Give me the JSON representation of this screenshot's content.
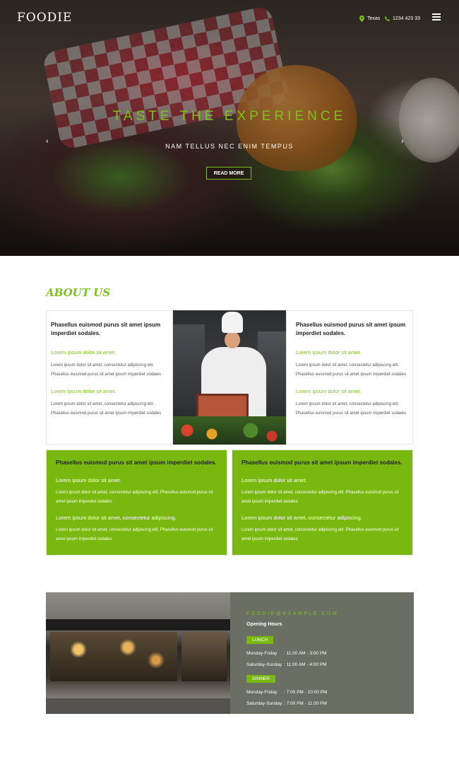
{
  "header": {
    "logo": "FOODIE",
    "location": "Texas",
    "phone": "1234 423 33"
  },
  "hero": {
    "title": "TASTE THE EXPERIENCE",
    "subtitle": "NAM TELLUS NEC ENIM TEMPUS",
    "button": "READ MORE",
    "prev_arrow": "‹",
    "next_arrow": "›"
  },
  "about": {
    "title": "ABOUT US",
    "left_card": {
      "heading": "Phasellus euismod purus sit amet ipsum imperdiet sodales.",
      "sub1": "Lorem ipsum dolor sit amet.",
      "text1": "Lorem ipsum dolor sit amet, consectetur adipiscing elit. Phasellus euismod purus sit amet ipsum imperdiet sodales",
      "sub2": "Lorem ipsum dolor sit amet.",
      "text2": "Lorem ipsum dolor sit amet, consectetur adipiscing elit. Phasellus euismod purus sit amet ipsum imperdiet sodales"
    },
    "right_card": {
      "heading": "Phasellus euismod purus sit amet ipsum imperdiet sodales.",
      "sub1": "Lorem ipsum dolor sit amet.",
      "text1": "Lorem ipsum dolor sit amet, consectetur adipiscing elit. Phasellus euismod purus sit amet ipsum imperdiet sodales",
      "sub2": "Lorem ipsum dolor sit amet.",
      "text2": "Lorem ipsum dolor sit amet, consectetur adipiscing elit. Phasellus euismod purus sit amet ipsum imperdiet sodales"
    },
    "green_left": {
      "heading": "Phasellus euismod purus sit amet ipsum imperdiet sodales.",
      "sub1": "Lorem ipsum dolor sit amet.",
      "text1": "Lorem ipsum dolor sit amet, consectetur adipiscing elit. Phasellus euismod purus sit amet ipsum imperdiet sodales",
      "sub2": "Lorem ipsum dolor sit amet, consectetur adipiscing.",
      "text2": "Lorem ipsum dolor sit amet, consectetur adipiscing elit. Phasellus euismod purus sit amet ipsum imperdiet sodales"
    },
    "green_right": {
      "heading": "Phasellus euismod purus sit amet ipsum imperdiet sodales.",
      "sub1": "Lorem ipsum dolor sit amet.",
      "text1": "Lorem ipsum dolor sit amet, consectetur adipiscing elit. Phasellus euismod purus sit amet ipsum imperdiet sodales",
      "sub2": "Lorem ipsum dolor sit amet, consectetur adipiscing.",
      "text2": "Lorem ipsum dolor sit amet, consectetur adipiscing elit. Phasellus euismod purus sit amet ipsum imperdiet sodales"
    }
  },
  "hours": {
    "email": "FOODIE@EXAMPLE.COM",
    "heading": "Opening Hours",
    "lunch_label": "LUNCH",
    "lunch": [
      {
        "day": "Monday-Friday",
        "time": ": 11:00 AM - 3:00 PM"
      },
      {
        "day": "Saturday-Sunday",
        "time": ": 11:00 AM - 4:00 PM"
      }
    ],
    "dinner_label": "DINNER",
    "dinner": [
      {
        "day": "Monday-Friday",
        "time": ": 7:00 PM - 10:00 PM"
      },
      {
        "day": "Saturday-Sunday",
        "time": ": 7:00 PM - 11:00 PM"
      }
    ]
  },
  "colors": {
    "accent": "#7cc21c",
    "green_panel": "#79b80f",
    "hours_panel": "#6b6e63"
  },
  "icons": {
    "location": "map-pin-icon",
    "phone": "phone-icon",
    "menu": "hamburger-menu-icon"
  }
}
